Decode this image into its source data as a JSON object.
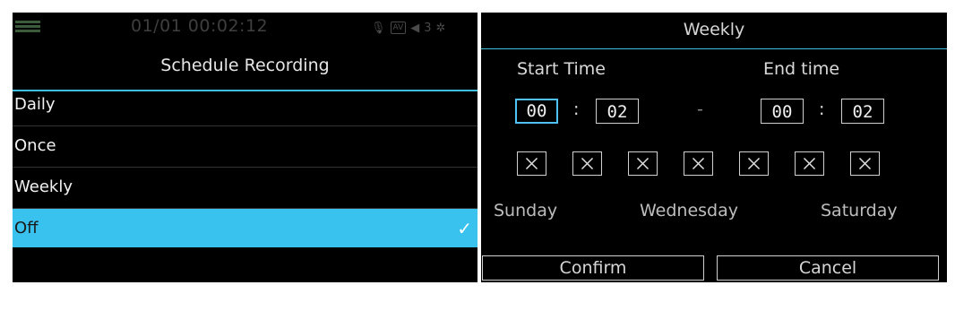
{
  "status_bar": {
    "time": "01/01 00:02:12",
    "av_badge": "AV",
    "volume": "3"
  },
  "schedule_menu": {
    "title": "Schedule Recording",
    "options": [
      {
        "label": "Daily"
      },
      {
        "label": "Once"
      },
      {
        "label": "Weekly"
      },
      {
        "label": "Off",
        "selected": true
      }
    ]
  },
  "weekly_dialog": {
    "title": "Weekly",
    "start_label": "Start Time",
    "end_label": "End time",
    "start_hour": "00",
    "start_minute": "02",
    "end_hour": "00",
    "end_minute": "02",
    "separator": ":",
    "range_dash": "-",
    "day_checkboxes": [
      "checked",
      "checked",
      "checked",
      "checked",
      "checked",
      "checked",
      "checked"
    ],
    "day_labels": [
      "Sunday",
      "Wednesday",
      "Saturday"
    ],
    "confirm_label": "Confirm",
    "cancel_label": "Cancel"
  },
  "colors": {
    "accent": "#39c2ee",
    "background": "#000000",
    "text": "#f2f2f2"
  }
}
